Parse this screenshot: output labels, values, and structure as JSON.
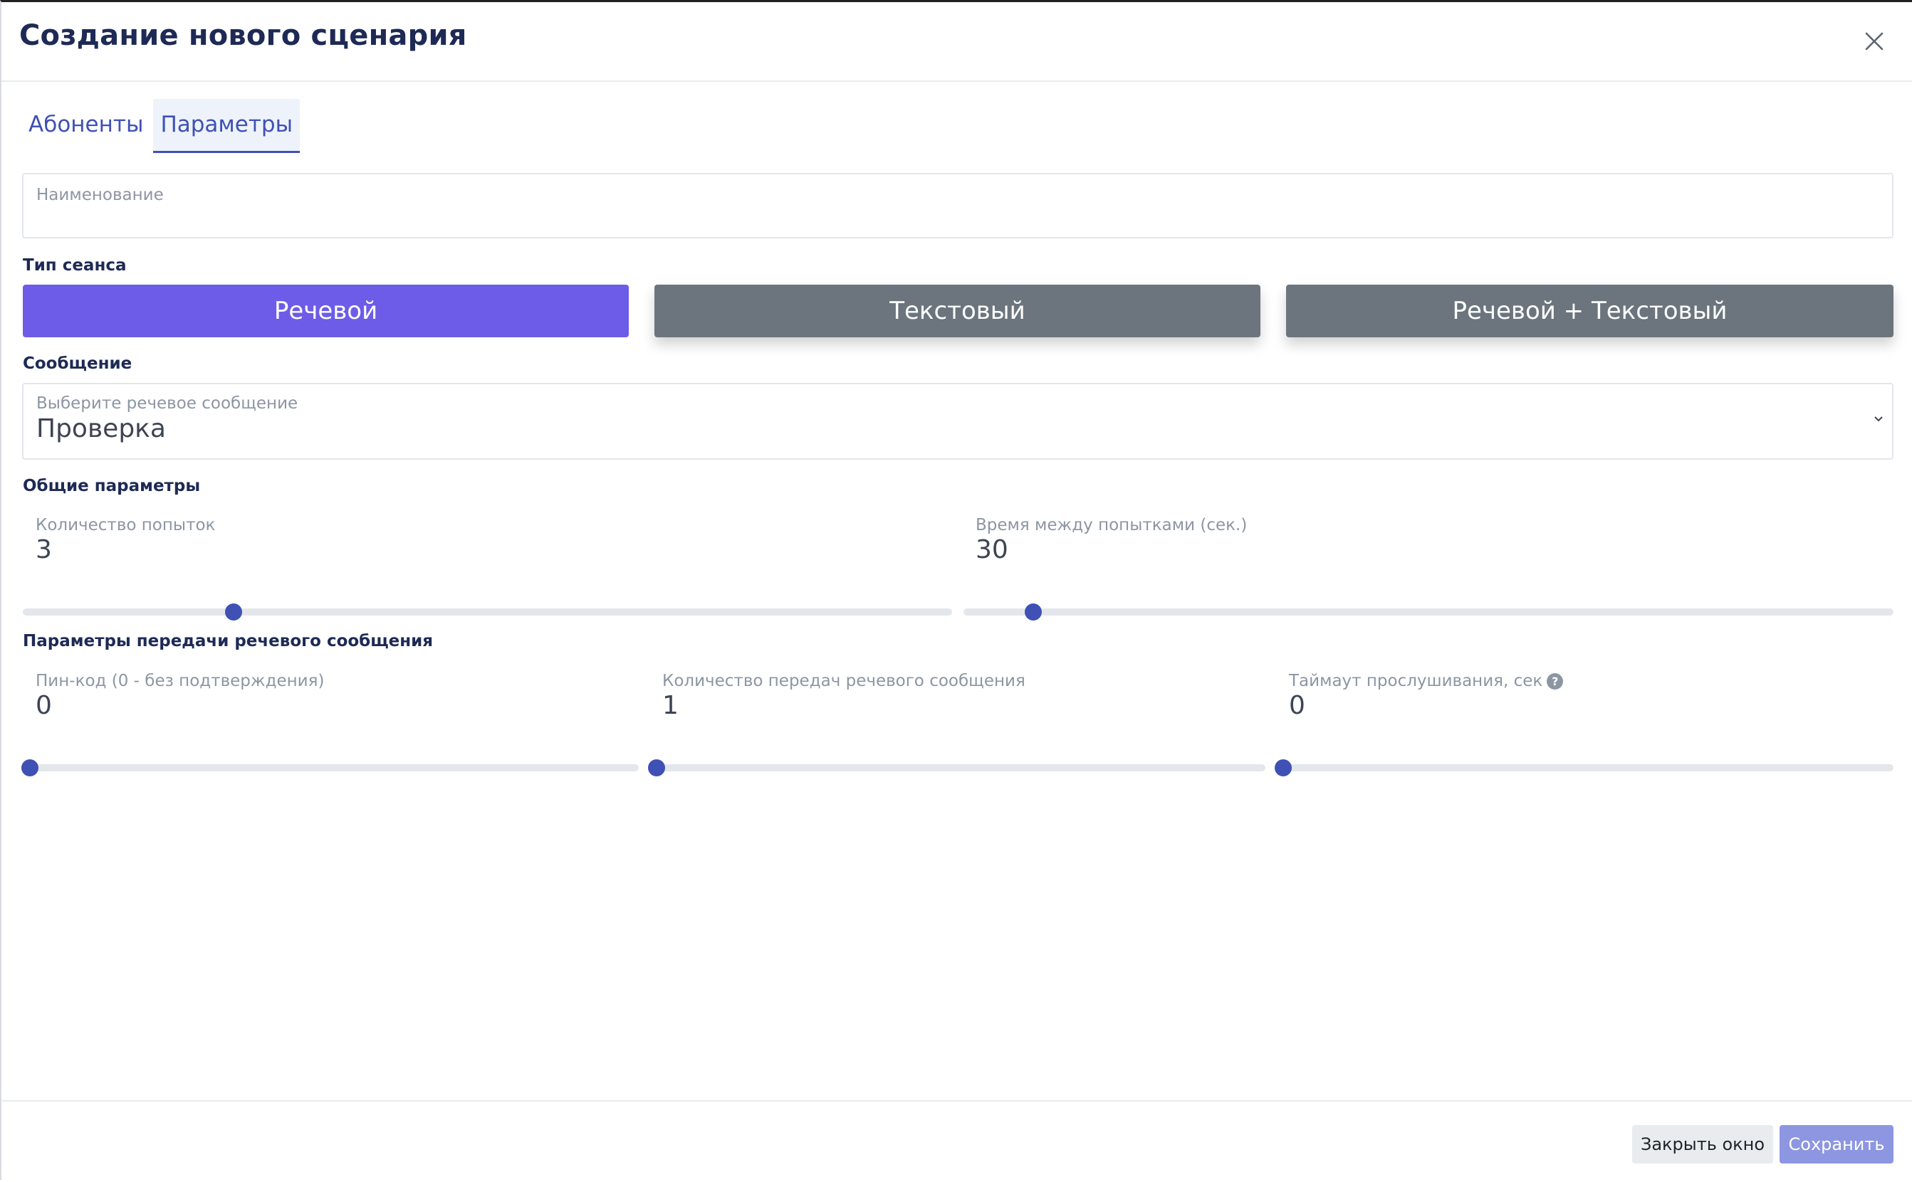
{
  "modal": {
    "title": "Создание нового сценария"
  },
  "tabs": [
    {
      "label": "Абоненты",
      "active": false
    },
    {
      "label": "Параметры",
      "active": true
    }
  ],
  "name_field": {
    "label": "Наименование",
    "value": ""
  },
  "session_type": {
    "label": "Тип сеанса",
    "options": [
      "Речевой",
      "Текстовый",
      "Речевой + Текстовый"
    ],
    "selected": "Речевой"
  },
  "message": {
    "section_label": "Сообщение",
    "select_label": "Выберите речевое сообщение",
    "value": "Проверка"
  },
  "general": {
    "section_label": "Общие параметры",
    "attempts": {
      "label": "Количество попыток",
      "value": "3",
      "fill": 0.227
    },
    "interval": {
      "label": "Время между попытками (сек.)",
      "value": "30",
      "fill": 0.075
    }
  },
  "voice_params": {
    "section_label": "Параметры передачи речевого сообщения",
    "pin": {
      "label": "Пин-код (0 - без подтверждения)",
      "value": "0",
      "fill": 0
    },
    "repeats": {
      "label": "Количество передач речевого сообщения",
      "value": "1",
      "fill": 0
    },
    "timeout": {
      "label": "Таймаут прослушивания, сек",
      "value": "0",
      "fill": 0,
      "help": "?"
    }
  },
  "footer": {
    "close_label": "Закрыть окно",
    "save_label": "Сохранить"
  },
  "colors": {
    "accent": "#3f51b5",
    "selected_type": "#6c5ce7",
    "unselected_type": "#6c757d",
    "save_button": "#8d96e0"
  }
}
